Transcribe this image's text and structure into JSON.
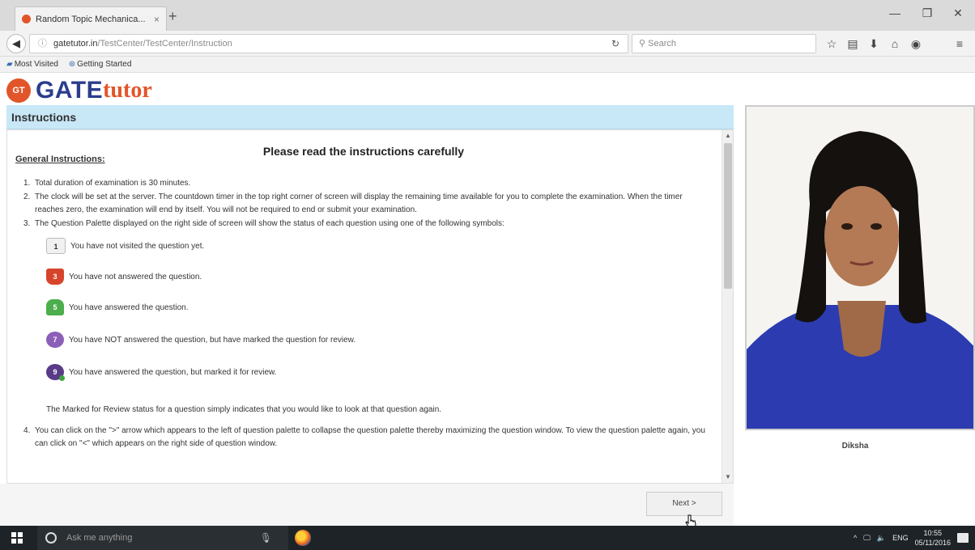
{
  "browser": {
    "tab_title": "Random Topic Mechanica...",
    "tab_close": "×",
    "new_tab": "+",
    "url_host": "gatetutor.in",
    "url_path": "/TestCenter/TestCenter/Instruction",
    "search_placeholder": "Search",
    "bookmarks": [
      "Most Visited",
      "Getting Started"
    ]
  },
  "logo": {
    "badge": "GT",
    "gate": "GATE",
    "tutor": "tutor"
  },
  "instructions": {
    "bar_title": "Instructions",
    "heading": "Please read the instructions carefully",
    "general_title": "General Instructions:",
    "items": [
      {
        "num": "1.",
        "text": "Total duration of examination is 30 minutes."
      },
      {
        "num": "2.",
        "text": "The clock will be set at the server. The countdown timer in the top right corner of screen will display the remaining time available for you to complete the examination. When the timer reaches zero, the examination will end by itself. You will not be required to end or submit your examination."
      },
      {
        "num": "3.",
        "text": "The Question Palette displayed on the right side of screen will show the status of each question using one of the following symbols:"
      }
    ],
    "symbols": [
      {
        "num": "1",
        "label": "You have not visited the question yet."
      },
      {
        "num": "3",
        "label": "You have not answered the question."
      },
      {
        "num": "5",
        "label": "You have answered the question."
      },
      {
        "num": "7",
        "label": "You have NOT answered the question, but have marked the question for review."
      },
      {
        "num": "9",
        "label": "You have answered the question, but marked it for review."
      }
    ],
    "marked_note": "The Marked for Review status for a question simply indicates that you would like to look at that question again.",
    "item4": {
      "num": "4.",
      "text": "You can click on the \">\" arrow which appears to the left of question palette to collapse the question palette thereby maximizing the question window. To view the question palette again, you can click on \"<\" which appears on the right side of question window."
    }
  },
  "next_button": "Next >",
  "candidate_name": "Diksha",
  "taskbar": {
    "search_placeholder": "Ask me anything",
    "lang": "ENG",
    "time": "10:55",
    "date": "05/11/2016"
  }
}
